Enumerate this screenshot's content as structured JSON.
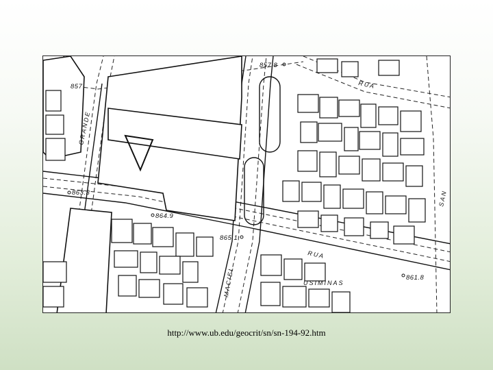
{
  "map": {
    "elevations": [
      "857.8",
      "857",
      "863.3",
      "864.9",
      "865.1",
      "861.8"
    ],
    "streets": [
      "GRANDE",
      "RUA",
      "MACIEL",
      "RUA",
      "USIMINAS",
      "SAN"
    ],
    "block_marker": "V",
    "ink_color": "#111111"
  },
  "footer": {
    "url": "http://www.ub.edu/geocrit/sn/sn-194-92.htm"
  }
}
